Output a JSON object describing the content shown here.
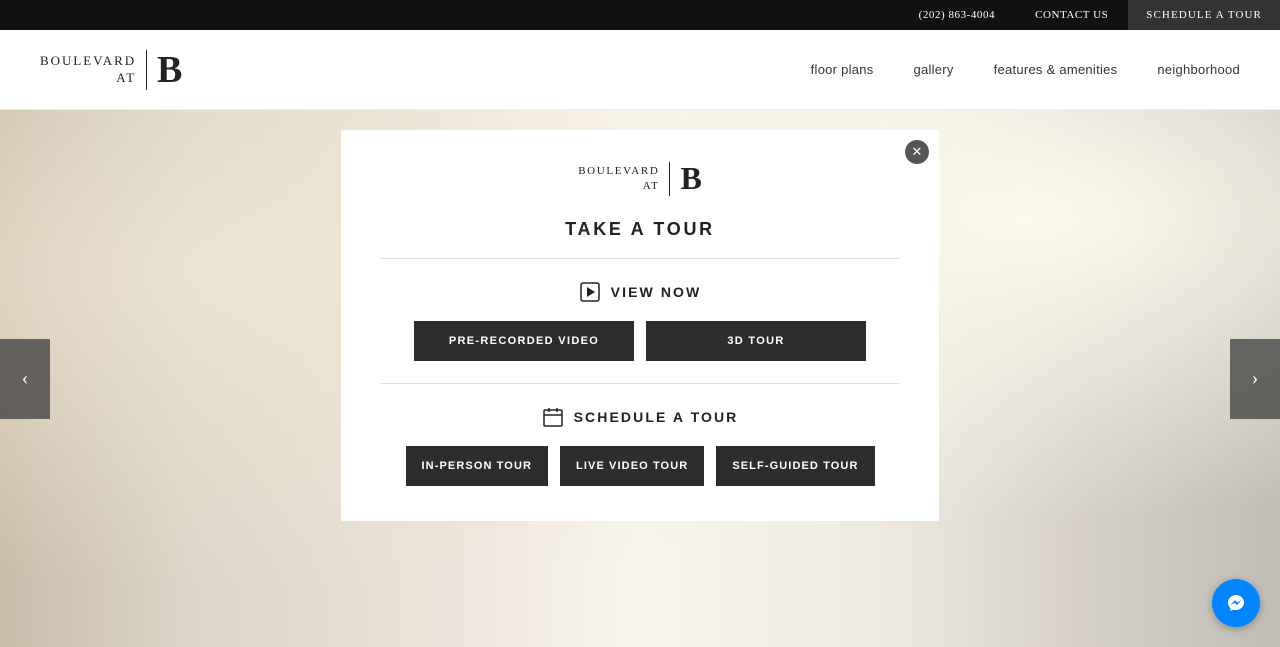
{
  "topbar": {
    "phone": "(202) 863-4004",
    "contact_label": "CONTACT US",
    "schedule_label": "SCHEDULE A TOUR"
  },
  "header": {
    "logo_line1": "BOULEVARD",
    "logo_line2": "AT",
    "logo_letter": "B",
    "nav": {
      "item1": "floor plans",
      "item2": "gallery",
      "item3": "features & amenities",
      "item4": "neighborhood"
    }
  },
  "arrows": {
    "left": "‹",
    "right": "›"
  },
  "modal": {
    "logo_line1": "BOULEVARD",
    "logo_line2": "AT",
    "logo_letter": "B",
    "title": "TAKE A TOUR",
    "view_section_title": "VIEW NOW",
    "btn_pre_recorded": "PRE-RECORDED VIDEO",
    "btn_3d": "3D TOUR",
    "schedule_section_title": "SCHEDULE A TOUR",
    "btn_in_person": "IN-PERSON TOUR",
    "btn_live_video": "LIVE VIDEO TOUR",
    "btn_self_guided": "SELF-GUIDED TOUR"
  }
}
